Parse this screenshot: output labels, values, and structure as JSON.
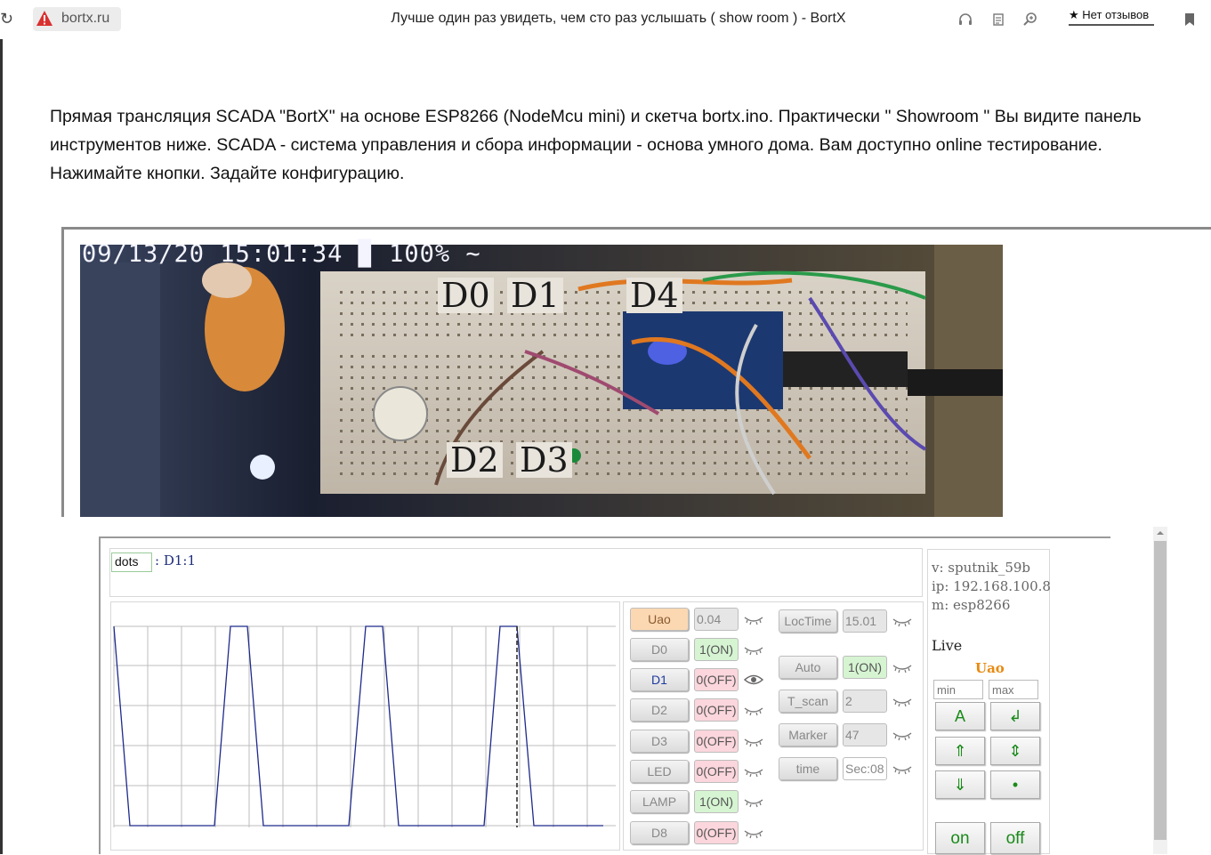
{
  "browser": {
    "domain": "bortx.ru",
    "title": "Лучше один раз увидеть, чем сто раз услышать ( show room ) - BortX",
    "reviews": "★ Нет отзывов",
    "icons": [
      "reload-icon",
      "warning-icon",
      "headphones-icon",
      "reader-icon",
      "zoom-icon",
      "bookmark-icon"
    ]
  },
  "article": {
    "lines": [
      "Прямая трансляция SCADA \"BortX\" на основе ESP8266 (NodeMcu mini) и скетча bortx.ino. Практически \" Showroom \" Вы видите панель",
      "инструментов ниже. SCADA - система управления и сбора информации - основа умного дома. Вам доступно online тестирование.",
      "Нажимайте кнопки. Задайте конфигурацию."
    ]
  },
  "camera": {
    "timestamp": "09/13/20 15:01:34 ▉ 100% ~",
    "pins": {
      "d0": "D0",
      "d1": "D1",
      "d4": "D4",
      "d2": "D2",
      "d3": "D3"
    }
  },
  "scada": {
    "mode": "dots",
    "probe": ": D1:1",
    "signals": [
      {
        "name": "Uao",
        "value": "0.04",
        "state": "gray"
      },
      {
        "name": "D0",
        "value": "1(ON)",
        "state": "on"
      },
      {
        "name": "D1",
        "value": "0(OFF)",
        "state": "off"
      },
      {
        "name": "D2",
        "value": "0(OFF)",
        "state": "off"
      },
      {
        "name": "D3",
        "value": "0(OFF)",
        "state": "off"
      },
      {
        "name": "LED",
        "value": "0(OFF)",
        "state": "off"
      },
      {
        "name": "LAMP",
        "value": "1(ON)",
        "state": "on"
      },
      {
        "name": "D8",
        "value": "0(OFF)",
        "state": "off"
      }
    ],
    "params": [
      {
        "name": "LocTime",
        "value": "15.01"
      },
      {
        "name": "Auto",
        "value": "1(ON)"
      },
      {
        "name": "T_scan",
        "value": "2"
      },
      {
        "name": "Marker",
        "value": "47"
      },
      {
        "name": "time",
        "value": "Sec:08"
      }
    ],
    "device": {
      "version": "v: sputnik_59b",
      "ip": "ip: 192.168.100.8",
      "model": "m: esp8266"
    },
    "live_label": "Live",
    "selected_signal": "Uao",
    "min_placeholder": "min",
    "max_placeholder": "max",
    "buttons": {
      "auto": "A",
      "enter": "↲",
      "up": "⇑",
      "updown": "⇕",
      "down": "⇓",
      "dot": "•",
      "on": "on",
      "off": "off"
    },
    "colors": {
      "on": "#d6f4d2",
      "off": "#fbd6dc",
      "trace": "#1e2a8a",
      "accent": "#e88a10"
    }
  }
}
